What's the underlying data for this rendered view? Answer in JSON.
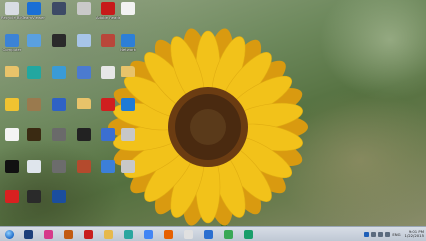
{
  "desktop": {
    "icons": [
      {
        "label": "Recycle Bin",
        "icon": "recycle-bin-icon",
        "color": "#d8dde3"
      },
      {
        "label": "TeamViewer 10",
        "icon": "teamviewer-icon",
        "color": "#1a6fd6"
      },
      {
        "label": "",
        "icon": "app-icon",
        "color": "#3d4a66"
      },
      {
        "label": "",
        "icon": "app-icon",
        "color": "#c9c9c9"
      },
      {
        "label": "Adobe Reader",
        "icon": "adobe-reader-icon",
        "color": "#c71a1a"
      },
      {
        "label": "",
        "icon": "document-icon",
        "color": "#f2f2f2"
      },
      {
        "label": "Computer",
        "icon": "computer-icon",
        "color": "#3c83d6"
      },
      {
        "label": "",
        "icon": "app-icon",
        "color": "#5aa0e0"
      },
      {
        "label": "",
        "icon": "app-icon",
        "color": "#2a2a2a"
      },
      {
        "label": "",
        "icon": "app-icon",
        "color": "#a7c5e8"
      },
      {
        "label": "",
        "icon": "app-icon",
        "color": "#b9463a"
      },
      {
        "label": "Network",
        "icon": "network-icon",
        "color": "#2d7fd8"
      },
      {
        "label": "",
        "icon": "folder-icon",
        "color": "#e8c36a"
      },
      {
        "label": "",
        "icon": "app-icon",
        "color": "#22a7a0"
      },
      {
        "label": "",
        "icon": "app-icon",
        "color": "#3a9bd6"
      },
      {
        "label": "",
        "icon": "app-icon",
        "color": "#4b7bd0"
      },
      {
        "label": "",
        "icon": "app-icon",
        "color": "#e7e7e7"
      },
      {
        "label": "",
        "icon": "folder-icon",
        "color": "#e8c36a"
      },
      {
        "label": "",
        "icon": "app-icon",
        "color": "#f0c331"
      },
      {
        "label": "",
        "icon": "app-icon",
        "color": "#9a7a4e"
      },
      {
        "label": "",
        "icon": "app-icon",
        "color": "#2f62c5"
      },
      {
        "label": "",
        "icon": "folder-icon",
        "color": "#e8c36a"
      },
      {
        "label": "",
        "icon": "adobe-acrobat-icon",
        "color": "#d01f1f"
      },
      {
        "label": "",
        "icon": "app-icon",
        "color": "#1f7bd6"
      },
      {
        "label": "",
        "icon": "document-icon",
        "color": "#f4f4f4"
      },
      {
        "label": "",
        "icon": "illustrator-icon",
        "color": "#3a2a12"
      },
      {
        "label": "",
        "icon": "app-icon",
        "color": "#6a6a6a"
      },
      {
        "label": "",
        "icon": "app-icon",
        "color": "#222222"
      },
      {
        "label": "",
        "icon": "app-icon",
        "color": "#3b6fd1"
      },
      {
        "label": "",
        "icon": "app-icon",
        "color": "#c7c7c7"
      },
      {
        "label": "",
        "icon": "app-icon",
        "color": "#111111"
      },
      {
        "label": "",
        "icon": "app-icon",
        "color": "#dfe5ec"
      },
      {
        "label": "",
        "icon": "app-icon",
        "color": "#6c6c6c"
      },
      {
        "label": "",
        "icon": "app-icon",
        "color": "#b44a2d"
      },
      {
        "label": "",
        "icon": "app-icon",
        "color": "#3c7fd8"
      },
      {
        "label": "",
        "icon": "app-icon",
        "color": "#c8c8c8"
      },
      {
        "label": "",
        "icon": "app-icon",
        "color": "#d82020"
      },
      {
        "label": "",
        "icon": "app-icon",
        "color": "#2a2a2a"
      },
      {
        "label": "",
        "icon": "app-icon",
        "color": "#1b4e9e"
      }
    ]
  },
  "taskbar": {
    "start_icon": "windows-start-icon",
    "apps": [
      {
        "icon": "photoshop-icon",
        "color": "#1d3f7a"
      },
      {
        "icon": "indesign-icon",
        "color": "#d63a8a"
      },
      {
        "icon": "illustrator-icon",
        "color": "#c25b12"
      },
      {
        "icon": "acrobat-icon",
        "color": "#c81e1e"
      },
      {
        "icon": "file-explorer-icon",
        "color": "#e6b94d"
      },
      {
        "icon": "app-icon",
        "color": "#2aa6a0"
      },
      {
        "icon": "chrome-icon",
        "color": "#4285f4"
      },
      {
        "icon": "firefox-icon",
        "color": "#e66000"
      },
      {
        "icon": "app-icon",
        "color": "#e0e0e0"
      },
      {
        "icon": "app-icon",
        "color": "#2b6fd0"
      },
      {
        "icon": "app-icon",
        "color": "#3aa856"
      },
      {
        "icon": "app-icon",
        "color": "#1a9e6a"
      }
    ],
    "tray": {
      "icons": [
        {
          "icon": "help-icon",
          "color": "#1e5fb8"
        },
        {
          "icon": "flag-icon",
          "color": "#5b6b7e"
        },
        {
          "icon": "network-icon",
          "color": "#5b6b7e"
        },
        {
          "icon": "volume-icon",
          "color": "#5b6b7e"
        }
      ],
      "language": "ENG",
      "time": "9:01 PM",
      "date": "1/22/2015"
    }
  },
  "colors": {
    "petal": "#f2c21a",
    "petal_shade": "#d99a10",
    "center": "#4a2a10",
    "taskbar": "#cdd4de"
  }
}
